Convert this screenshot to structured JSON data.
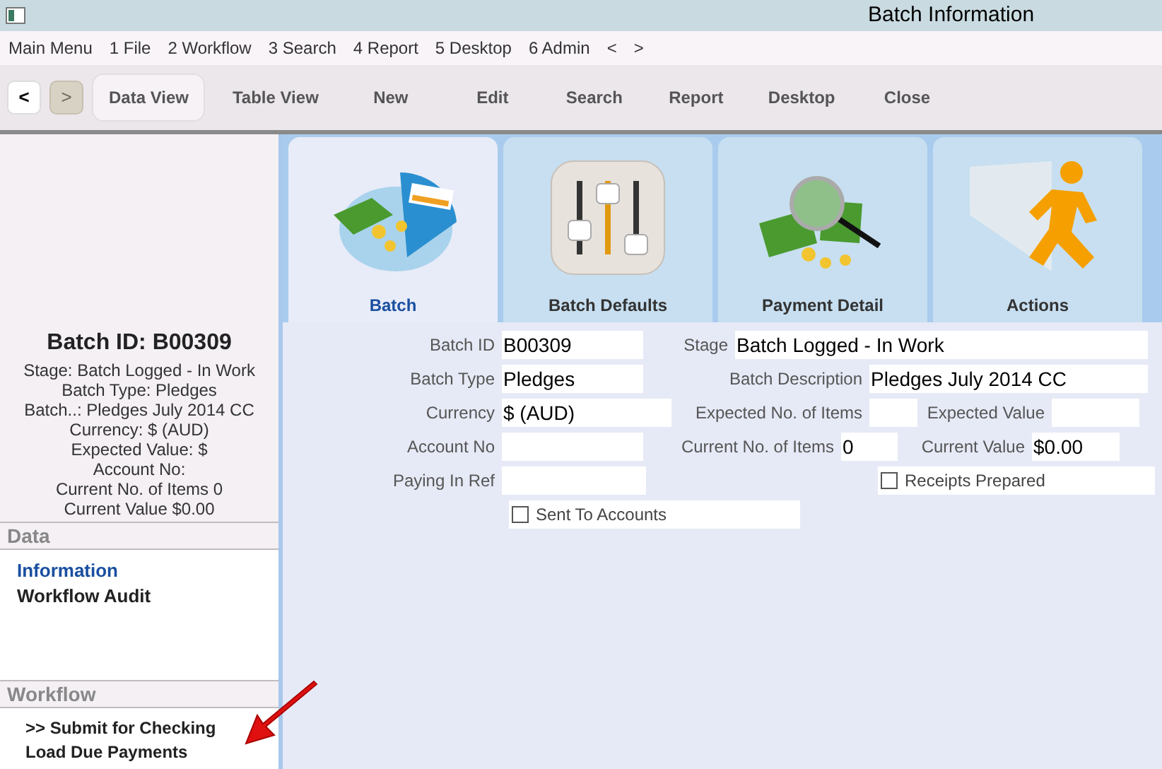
{
  "window": {
    "title": "Batch Information"
  },
  "menu": [
    "Main Menu",
    "1 File",
    "2 Workflow",
    "3 Search",
    "4 Report",
    "5 Desktop",
    "6 Admin",
    "<",
    ">"
  ],
  "nav_buttons": [
    {
      "label": "<",
      "disabled": false
    },
    {
      "label": ">",
      "disabled": true
    }
  ],
  "toolbar": [
    {
      "label": "Data View",
      "selected": true
    },
    {
      "label": "Table View",
      "selected": false
    },
    {
      "label": "New",
      "selected": false
    },
    {
      "label": "Edit",
      "selected": false
    },
    {
      "label": "Search",
      "selected": false
    },
    {
      "label": "Report",
      "selected": false
    },
    {
      "label": "Desktop",
      "selected": false
    },
    {
      "label": "Close",
      "selected": false
    }
  ],
  "summary": {
    "title": "Batch ID: B00309",
    "lines": [
      "Stage: Batch Logged - In Work",
      "Batch Type: Pledges",
      "Batch..: Pledges July 2014 CC",
      "Currency: $ (AUD)",
      "Expected Value: $",
      "Account No:",
      "Current No. of Items 0",
      "Current Value $0.00"
    ]
  },
  "sections": [
    {
      "title": "Data",
      "items": [
        {
          "label": "Information",
          "selected": true,
          "kind": "link"
        },
        {
          "label": "Workflow Audit",
          "selected": false,
          "kind": "link"
        }
      ]
    },
    {
      "title": "Workflow",
      "items": [
        {
          "label": ">> Submit for Checking",
          "selected": false,
          "kind": "action"
        },
        {
          "label": "Load Due Payments",
          "selected": false,
          "kind": "link"
        }
      ]
    }
  ],
  "tabs": [
    {
      "label": "Batch",
      "selected": true,
      "kind": "batch"
    },
    {
      "label": "Batch Defaults",
      "selected": false,
      "kind": "defaults"
    },
    {
      "label": "Payment Detail",
      "selected": false,
      "kind": "payment"
    },
    {
      "label": "Actions",
      "selected": false,
      "kind": "actions"
    }
  ],
  "form": {
    "rows": [
      [
        {
          "kind": "text",
          "label": "Batch ID",
          "value": "B00309"
        },
        {
          "kind": "text",
          "label": "Stage",
          "value": "Batch Logged - In Work"
        }
      ],
      [
        {
          "kind": "text",
          "label": "Batch Type",
          "value": "Pledges"
        },
        {
          "kind": "text",
          "label": "Batch Description",
          "value": "Pledges July 2014 CC"
        }
      ],
      [
        {
          "kind": "text",
          "label": "Currency",
          "value": "$ (AUD)"
        },
        {
          "kind": "text",
          "label": "Expected No. of Items"
        },
        {
          "kind": "text",
          "label": "Expected Value"
        }
      ],
      [
        {
          "kind": "text",
          "label": "Account No"
        },
        {
          "kind": "text",
          "label": "Current No. of Items",
          "value": "0"
        },
        {
          "kind": "text",
          "label": "Current Value",
          "value": "$0.00"
        }
      ],
      [
        {
          "kind": "text",
          "label": "Paying In Ref"
        },
        {
          "kind": "checkbox",
          "label": "Receipts Prepared",
          "checked": false
        }
      ],
      [
        {
          "kind": "checkbox",
          "label": "Sent To Accounts",
          "checked": false
        }
      ]
    ]
  }
}
